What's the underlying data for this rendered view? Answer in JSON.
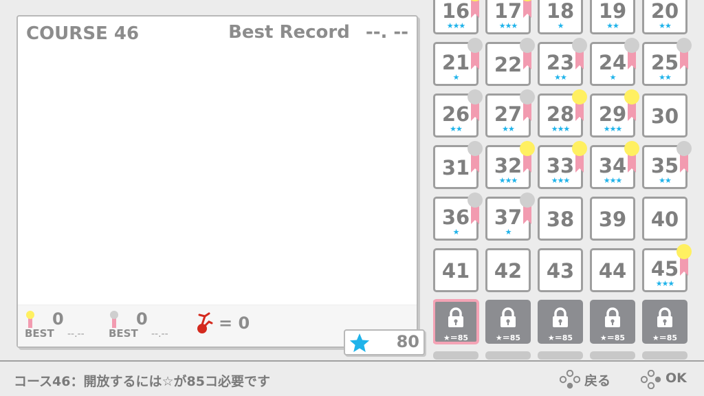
{
  "course_info": {
    "title": "COURSE 46",
    "best_record_label": "Best Record",
    "best_record_value": "--. --",
    "gold": {
      "count": "0",
      "best_label": "BEST",
      "best_time": "--.--"
    },
    "silver": {
      "count": "0",
      "best_label": "BEST",
      "best_time": "--.--"
    },
    "fails": "= 0"
  },
  "stars_total": "80",
  "courses": [
    {
      "num": "16",
      "stars": "★★★",
      "medal": "gold"
    },
    {
      "num": "17",
      "stars": "★★★",
      "medal": "gold"
    },
    {
      "num": "18",
      "stars": "★",
      "medal": "none"
    },
    {
      "num": "19",
      "stars": "★★",
      "medal": "none"
    },
    {
      "num": "20",
      "stars": "★★",
      "medal": "none"
    },
    {
      "num": "21",
      "stars": "★",
      "medal": "silver"
    },
    {
      "num": "22",
      "stars": "",
      "medal": "silver"
    },
    {
      "num": "23",
      "stars": "★★",
      "medal": "silver"
    },
    {
      "num": "24",
      "stars": "★",
      "medal": "silver"
    },
    {
      "num": "25",
      "stars": "★★",
      "medal": "silver"
    },
    {
      "num": "26",
      "stars": "★★",
      "medal": "silver"
    },
    {
      "num": "27",
      "stars": "★★",
      "medal": "silver"
    },
    {
      "num": "28",
      "stars": "★★★",
      "medal": "gold"
    },
    {
      "num": "29",
      "stars": "★★★",
      "medal": "gold"
    },
    {
      "num": "30",
      "stars": "",
      "medal": "none"
    },
    {
      "num": "31",
      "stars": "",
      "medal": "silver"
    },
    {
      "num": "32",
      "stars": "★★★",
      "medal": "gold"
    },
    {
      "num": "33",
      "stars": "★★★",
      "medal": "gold"
    },
    {
      "num": "34",
      "stars": "★★★",
      "medal": "gold"
    },
    {
      "num": "35",
      "stars": "★★",
      "medal": "silver"
    },
    {
      "num": "36",
      "stars": "★",
      "medal": "silver"
    },
    {
      "num": "37",
      "stars": "★",
      "medal": "silver"
    },
    {
      "num": "38",
      "stars": "",
      "medal": "none"
    },
    {
      "num": "39",
      "stars": "",
      "medal": "none"
    },
    {
      "num": "40",
      "stars": "",
      "medal": "none"
    },
    {
      "num": "41",
      "stars": "",
      "medal": "none"
    },
    {
      "num": "42",
      "stars": "",
      "medal": "none"
    },
    {
      "num": "43",
      "stars": "",
      "medal": "none"
    },
    {
      "num": "44",
      "stars": "",
      "medal": "none"
    },
    {
      "num": "45",
      "stars": "★★★",
      "medal": "gold"
    }
  ],
  "locked_courses": [
    {
      "requirement": "★＝85",
      "selected": true
    },
    {
      "requirement": "★＝85",
      "selected": false
    },
    {
      "requirement": "★＝85",
      "selected": false
    },
    {
      "requirement": "★＝85",
      "selected": false
    },
    {
      "requirement": "★＝85",
      "selected": false
    }
  ],
  "status_message": "コース46：開放するには☆が85コ必要です",
  "controls": {
    "back": "戻る",
    "ok": "OK"
  },
  "colors": {
    "star": "#1fb3ea",
    "gold": "#fff061",
    "silver": "#cfcfcf",
    "ribbon": "#f29bb0",
    "locked": "#8c8d91",
    "selected": "#f4a3b5"
  }
}
